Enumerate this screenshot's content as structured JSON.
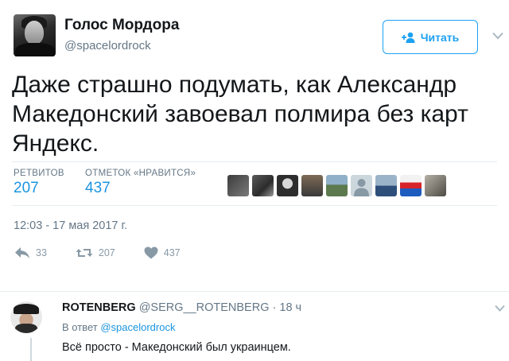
{
  "tweet": {
    "author_name": "Голос Мордора",
    "author_handle": "@spacelordrock",
    "follow_label": "Читать",
    "text": "Даже страшно подумать, как Александр Македонский завоевал полмира без карт Яндекс.",
    "stats": {
      "retweets_label": "РЕТВИТОВ",
      "retweets_value": "207",
      "likes_label": "ОТМЕТОК «НРАВИТСЯ»",
      "likes_value": "437"
    },
    "timestamp": "12:03 - 17 мая 2017 г.",
    "actions": {
      "reply_count": "33",
      "retweet_count": "207",
      "like_count": "437"
    },
    "likers": [
      {
        "icon": "liker-avatar-1"
      },
      {
        "icon": "liker-avatar-2"
      },
      {
        "icon": "liker-avatar-3"
      },
      {
        "icon": "liker-avatar-4"
      },
      {
        "icon": "liker-avatar-5"
      },
      {
        "icon": "default-egg-avatar"
      },
      {
        "icon": "liker-avatar-7"
      },
      {
        "icon": "liker-avatar-8"
      },
      {
        "icon": "liker-avatar-9"
      }
    ]
  },
  "reply": {
    "author_name": "ROTENBERG",
    "author_handle": "@SERG__ROTENBERG",
    "separator": "·",
    "time": "18 ч",
    "in_reply_prefix": "В ответ",
    "in_reply_handle": "@spacelordrock",
    "text": "Всё просто - Македонский был украинцем."
  },
  "colors": {
    "accent": "#1da1f2",
    "link": "#1b95e0",
    "muted": "#657786",
    "text": "#14171a"
  }
}
